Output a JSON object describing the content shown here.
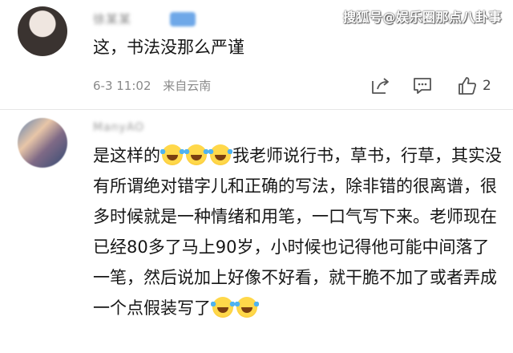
{
  "watermark": "搜狐号@娱乐圈那点八卦事",
  "comments": [
    {
      "username": "徐某某",
      "text": "这，书法没那么严谨",
      "date": "6-3 11:02",
      "location": "来自云南",
      "likes": "2"
    },
    {
      "username": "ManyAO",
      "text_parts": [
        "是这样的",
        "我老师说行书，草书，行草，其实没有所谓绝对错字儿和正确的写法，除非错的很离谱，很多时候就是一种情绪和用笔，一口气写下来。老师现在已经80多了马上90岁，小时候也记得他可能中间落了一笔，然后说加上好像不好看，就干脆不加了或者弄成一个点假装写了"
      ]
    }
  ],
  "icons": {
    "share": "share-icon",
    "reply": "comment-icon",
    "like": "thumbs-up-icon",
    "emoji": "laughing-tears-emoji"
  }
}
